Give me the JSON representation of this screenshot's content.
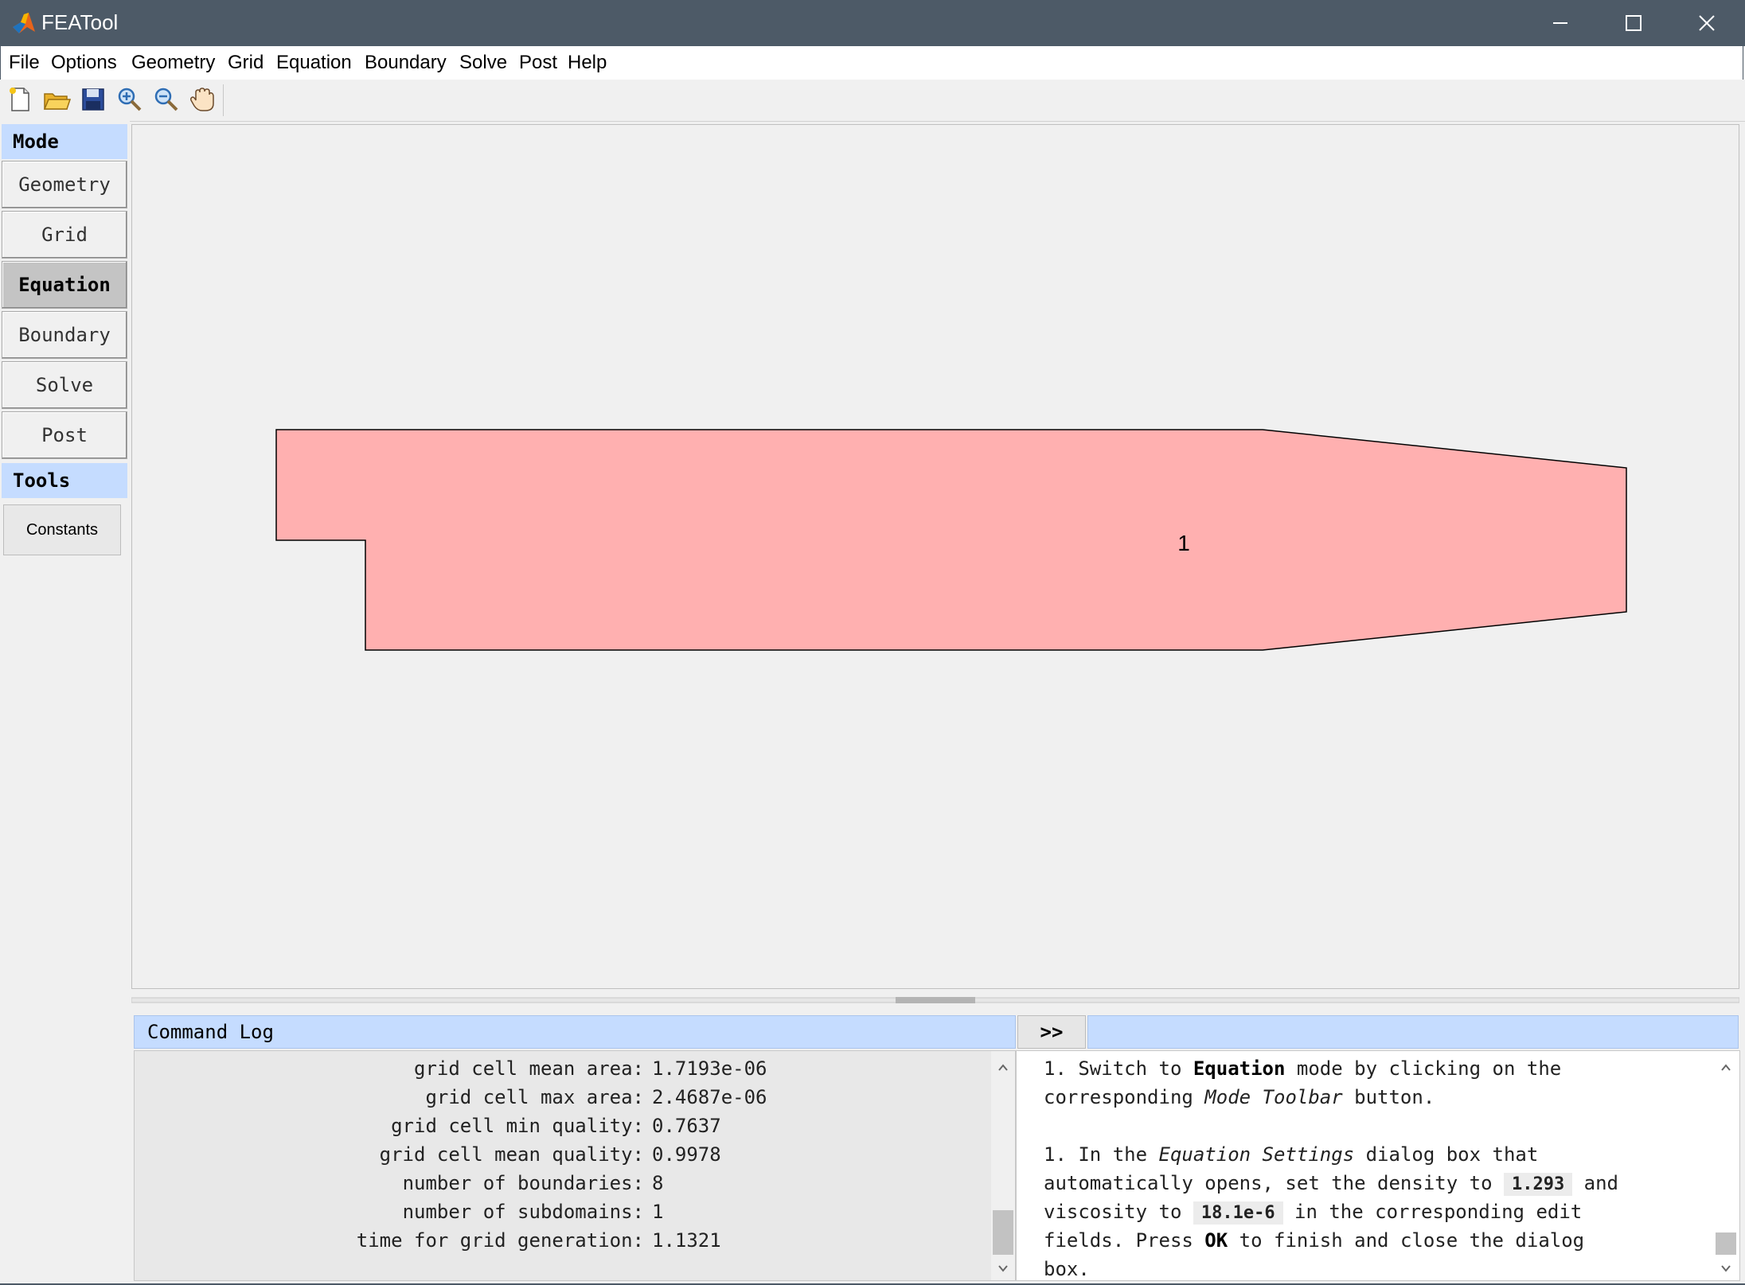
{
  "window": {
    "title": "FEATool",
    "accent_color": "#4d5a67"
  },
  "menu": [
    "File",
    "Options",
    "Geometry",
    "Grid",
    "Equation",
    "Boundary",
    "Solve",
    "Post",
    "Help"
  ],
  "toolbar": {
    "icons": [
      "new-file-icon",
      "open-folder-icon",
      "save-icon",
      "zoom-in-icon",
      "zoom-out-icon",
      "pan-hand-icon"
    ]
  },
  "sidebar": {
    "mode_header": "Mode",
    "modes": [
      {
        "label": "Geometry"
      },
      {
        "label": "Grid"
      },
      {
        "label": "Equation",
        "active": true
      },
      {
        "label": "Boundary"
      },
      {
        "label": "Solve"
      },
      {
        "label": "Post"
      }
    ],
    "tools_header": "Tools",
    "tools_button": "Constants"
  },
  "canvas": {
    "subdomain_label": "1",
    "fill_color": "#ffb0b0"
  },
  "command_log": {
    "header": "Command Log",
    "expand_button": ">>",
    "lines": [
      {
        "label": "grid cell mean area:",
        "value": "1.7193e-06"
      },
      {
        "label": "grid cell max area:",
        "value": "2.4687e-06"
      },
      {
        "label": "grid cell min quality:",
        "value": "0.7637"
      },
      {
        "label": "grid cell mean quality:",
        "value": "0.9978"
      },
      {
        "label": "number of boundaries:",
        "value": "8"
      },
      {
        "label": "number of subdomains:",
        "value": "1"
      },
      {
        "label": "time for grid generation:",
        "value": "1.1321"
      }
    ]
  },
  "help": {
    "l1_a": "1. Switch to ",
    "l1_b": "Equation",
    "l1_c": " mode by clicking on the",
    "l2_a": "corresponding ",
    "l2_b": "Mode Toolbar",
    "l2_c": " button.",
    "l3_a": "1. In the ",
    "l3_b": "Equation Settings",
    "l3_c": " dialog box that",
    "l4_a": "automatically opens, set the density to ",
    "l4_code": "1.293",
    "l4_c": " and",
    "l5_a": "viscosity to ",
    "l5_code": "18.1e-6",
    "l5_c": " in the corresponding edit",
    "l6_a": "fields. Press ",
    "l6_b": "OK",
    "l6_c": " to finish and close the dialog",
    "l7": "box."
  }
}
